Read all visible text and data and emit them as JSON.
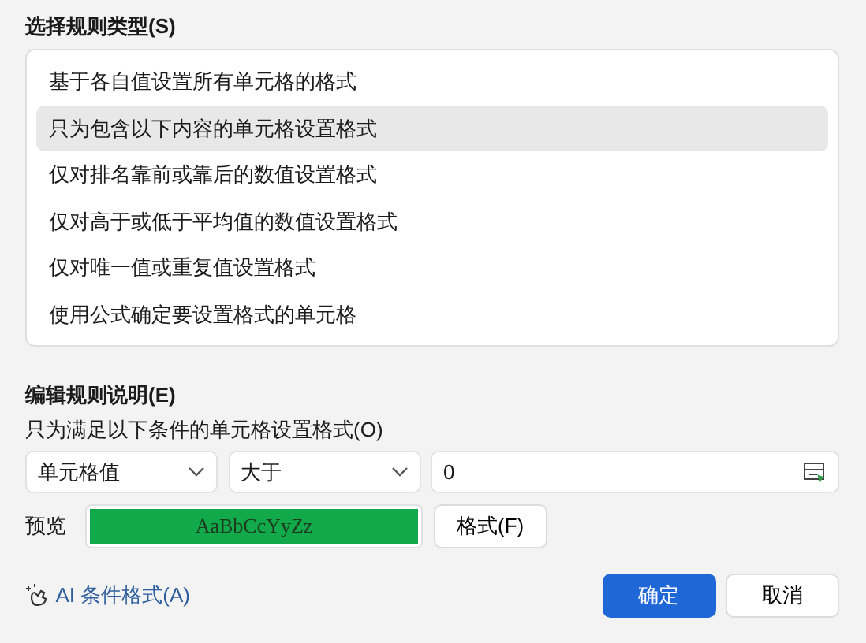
{
  "rule_type": {
    "title": "选择规则类型(S)",
    "items": [
      {
        "label": "基于各自值设置所有单元格的格式",
        "selected": false
      },
      {
        "label": "只为包含以下内容的单元格设置格式",
        "selected": true
      },
      {
        "label": "仅对排名靠前或靠后的数值设置格式",
        "selected": false
      },
      {
        "label": "仅对高于或低于平均值的数值设置格式",
        "selected": false
      },
      {
        "label": "仅对唯一值或重复值设置格式",
        "selected": false
      },
      {
        "label": "使用公式确定要设置格式的单元格",
        "selected": false
      }
    ]
  },
  "rule_edit": {
    "title": "编辑规则说明(E)",
    "subtitle": "只为满足以下条件的单元格设置格式(O)",
    "condition": {
      "field": "单元格值",
      "operator": "大于",
      "value": "0"
    },
    "preview": {
      "label": "预览",
      "sample": "AaBbCcYyZz",
      "color": "#12a94a"
    },
    "format_button": "格式(F)"
  },
  "ai_link": "AI 条件格式(A)",
  "buttons": [
    {
      "label": "确定",
      "kind": "primary"
    },
    {
      "label": "取消",
      "kind": "secondary"
    }
  ]
}
